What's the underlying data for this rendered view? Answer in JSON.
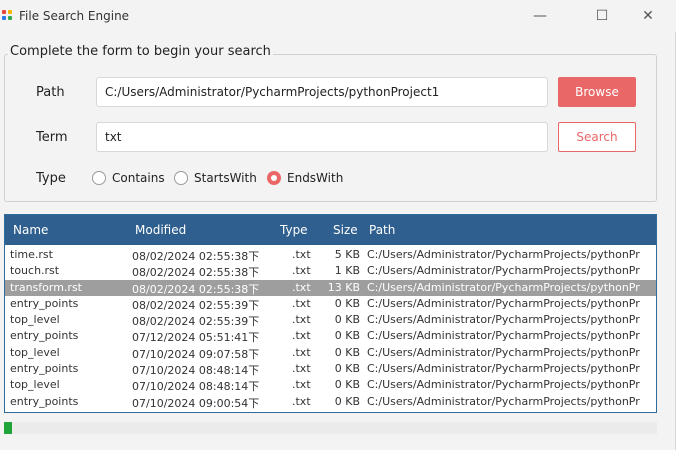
{
  "window": {
    "title": "File Search Engine",
    "controls": {
      "minimize": "—",
      "maximize": "☐",
      "close": "✕"
    }
  },
  "form": {
    "legend": "Complete the form to begin your search",
    "path_label": "Path",
    "path_value": "C:/Users/Administrator/PycharmProjects/pythonProject1",
    "browse_label": "Browse",
    "term_label": "Term",
    "term_value": "txt",
    "search_label": "Search",
    "type_label": "Type",
    "type_options": [
      {
        "label": "Contains",
        "checked": false
      },
      {
        "label": "StartsWith",
        "checked": false
      },
      {
        "label": "EndsWith",
        "checked": true
      }
    ]
  },
  "table": {
    "columns": [
      "Name",
      "Modified",
      "Type",
      "Size",
      "Path"
    ],
    "selected_row": 2,
    "rows": [
      [
        "time.rst",
        "08/02/2024 02:55:38下",
        ".txt",
        "5 KB",
        "C:/Users/Administrator/PycharmProjects/pythonPr"
      ],
      [
        "touch.rst",
        "08/02/2024 02:55:38下",
        ".txt",
        "1 KB",
        "C:/Users/Administrator/PycharmProjects/pythonPr"
      ],
      [
        "transform.rst",
        "08/02/2024 02:55:38下",
        ".txt",
        "13 KB",
        "C:/Users/Administrator/PycharmProjects/pythonPr"
      ],
      [
        "entry_points",
        "08/02/2024 02:55:39下",
        ".txt",
        "0 KB",
        "C:/Users/Administrator/PycharmProjects/pythonPr"
      ],
      [
        "top_level",
        "08/02/2024 02:55:39下",
        ".txt",
        "0 KB",
        "C:/Users/Administrator/PycharmProjects/pythonPr"
      ],
      [
        "entry_points",
        "07/12/2024 05:51:41下",
        ".txt",
        "0 KB",
        "C:/Users/Administrator/PycharmProjects/pythonPr"
      ],
      [
        "top_level",
        "07/10/2024 09:07:58下",
        ".txt",
        "0 KB",
        "C:/Users/Administrator/PycharmProjects/pythonPr"
      ],
      [
        "entry_points",
        "07/10/2024 08:48:14下",
        ".txt",
        "0 KB",
        "C:/Users/Administrator/PycharmProjects/pythonPr"
      ],
      [
        "top_level",
        "07/10/2024 08:48:14下",
        ".txt",
        "0 KB",
        "C:/Users/Administrator/PycharmProjects/pythonPr"
      ],
      [
        "entry_points",
        "07/10/2024 09:00:54下",
        ".txt",
        "0 KB",
        "C:/Users/Administrator/PycharmProjects/pythonPr"
      ]
    ]
  },
  "progress": {
    "fraction": 0.012
  },
  "colors": {
    "accent": "#ea6767",
    "header": "#2f5f8e",
    "selected_row": "#9e9e9e",
    "progress": "#1fa43a"
  },
  "icons": [
    "app-icon",
    "minimize-icon",
    "maximize-icon",
    "close-icon"
  ]
}
